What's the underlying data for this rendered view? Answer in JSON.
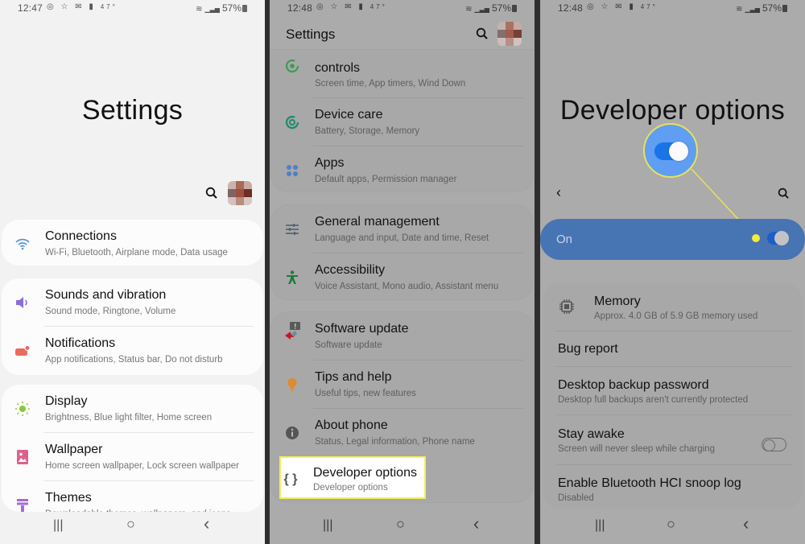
{
  "panels": [
    {
      "status": {
        "time": "12:47",
        "left_icons": "◎ ☆ ✉ ▮",
        "temp": "47°",
        "battery": "57%"
      },
      "title": "Settings",
      "cards": [
        {
          "items": [
            {
              "icon": "wifi-icon",
              "title": "Connections",
              "subtitle": "Wi-Fi, Bluetooth, Airplane mode, Data usage"
            }
          ]
        },
        {
          "items": [
            {
              "icon": "speaker-icon",
              "title": "Sounds and vibration",
              "subtitle": "Sound mode, Ringtone, Volume"
            },
            {
              "icon": "notification-icon",
              "title": "Notifications",
              "subtitle": "App notifications, Status bar, Do not disturb"
            }
          ]
        },
        {
          "items": [
            {
              "icon": "brightness-icon",
              "title": "Display",
              "subtitle": "Brightness, Blue light filter, Home screen"
            },
            {
              "icon": "wallpaper-icon",
              "title": "Wallpaper",
              "subtitle": "Home screen wallpaper, Lock screen wallpaper"
            },
            {
              "icon": "themes-icon",
              "title": "Themes",
              "subtitle": "Downloadable themes, wallpapers, and icons"
            }
          ]
        }
      ]
    },
    {
      "status": {
        "time": "12:48",
        "left_icons": "◎ ☆ ✉ ▮",
        "temp": "47°",
        "battery": "57%"
      },
      "title": "Settings",
      "cards": [
        {
          "items": [
            {
              "icon": "digital-wellbeing-icon",
              "title": "controls",
              "subtitle": "Screen time, App timers, Wind Down"
            },
            {
              "icon": "device-care-icon",
              "title": "Device care",
              "subtitle": "Battery, Storage, Memory"
            },
            {
              "icon": "apps-icon",
              "title": "Apps",
              "subtitle": "Default apps, Permission manager"
            }
          ]
        },
        {
          "items": [
            {
              "icon": "sliders-icon",
              "title": "General management",
              "subtitle": "Language and input, Date and time, Reset"
            },
            {
              "icon": "accessibility-icon",
              "title": "Accessibility",
              "subtitle": "Voice Assistant, Mono audio, Assistant menu"
            }
          ]
        },
        {
          "items": [
            {
              "icon": "software-update-icon",
              "title": "Software update",
              "subtitle": "Software update"
            },
            {
              "icon": "lightbulb-icon",
              "title": "Tips and help",
              "subtitle": "Useful tips, new features"
            },
            {
              "icon": "info-icon",
              "title": "About phone",
              "subtitle": "Status, Legal information, Phone name"
            },
            {
              "icon": "braces-icon",
              "title": "Developer options",
              "subtitle": "Developer options",
              "highlighted": true
            }
          ]
        }
      ]
    },
    {
      "status": {
        "time": "12:48",
        "left_icons": "◎ ☆ ✉ ▮",
        "temp": "47°",
        "battery": "57%"
      },
      "title": "Developer options",
      "master_switch": {
        "label": "On",
        "on": true
      },
      "items": [
        {
          "icon": "chip-icon",
          "title": "Memory",
          "subtitle": "Approx. 4.0 GB of 5.9 GB memory used"
        },
        {
          "title": "Bug report",
          "subtitle": ""
        },
        {
          "title": "Desktop backup password",
          "subtitle": "Desktop full backups aren't currently protected"
        },
        {
          "title": "Stay awake",
          "subtitle": "Screen will never sleep while charging",
          "toggle": false
        },
        {
          "title": "Enable Bluetooth HCI snoop log",
          "subtitle": "Disabled"
        }
      ]
    }
  ],
  "navbar": {
    "recents": "|||",
    "home": "○",
    "back": "‹"
  },
  "colors": {
    "on_bar": "#4774b3",
    "callout": "#f3ee5a",
    "toggle_on": "#1a74e8"
  }
}
